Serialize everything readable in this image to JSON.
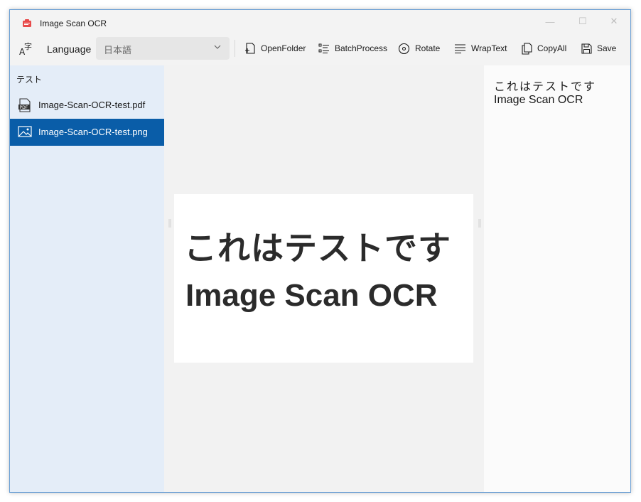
{
  "window": {
    "title": "Image Scan OCR",
    "controls": {
      "minimize": "—",
      "maximize": "☐",
      "close": "✕"
    }
  },
  "toolbar": {
    "language_label": "Language",
    "language_value": "日本語",
    "buttons": [
      {
        "label": "OpenFolder",
        "icon": "open-folder-icon"
      },
      {
        "label": "BatchProcess",
        "icon": "batch-process-icon"
      },
      {
        "label": "Rotate",
        "icon": "rotate-icon"
      },
      {
        "label": "WrapText",
        "icon": "wrap-text-icon"
      },
      {
        "label": "CopyAll",
        "icon": "copy-icon"
      },
      {
        "label": "Save",
        "icon": "save-icon"
      }
    ]
  },
  "sidebar": {
    "group_label": "テスト",
    "items": [
      {
        "label": "Image-Scan-OCR-test.pdf",
        "icon": "pdf-file-icon",
        "selected": false
      },
      {
        "label": "Image-Scan-OCR-test.png",
        "icon": "image-file-icon",
        "selected": true
      }
    ]
  },
  "preview": {
    "line1": "これはテストです",
    "line2": "Image Scan OCR"
  },
  "ocr_result": {
    "lines": [
      "これはテストです",
      "Image Scan OCR"
    ]
  },
  "colors": {
    "accent": "#0a5da8",
    "sidebar_bg": "#e4edf8",
    "toolbar_bg": "#f3f3f3"
  }
}
